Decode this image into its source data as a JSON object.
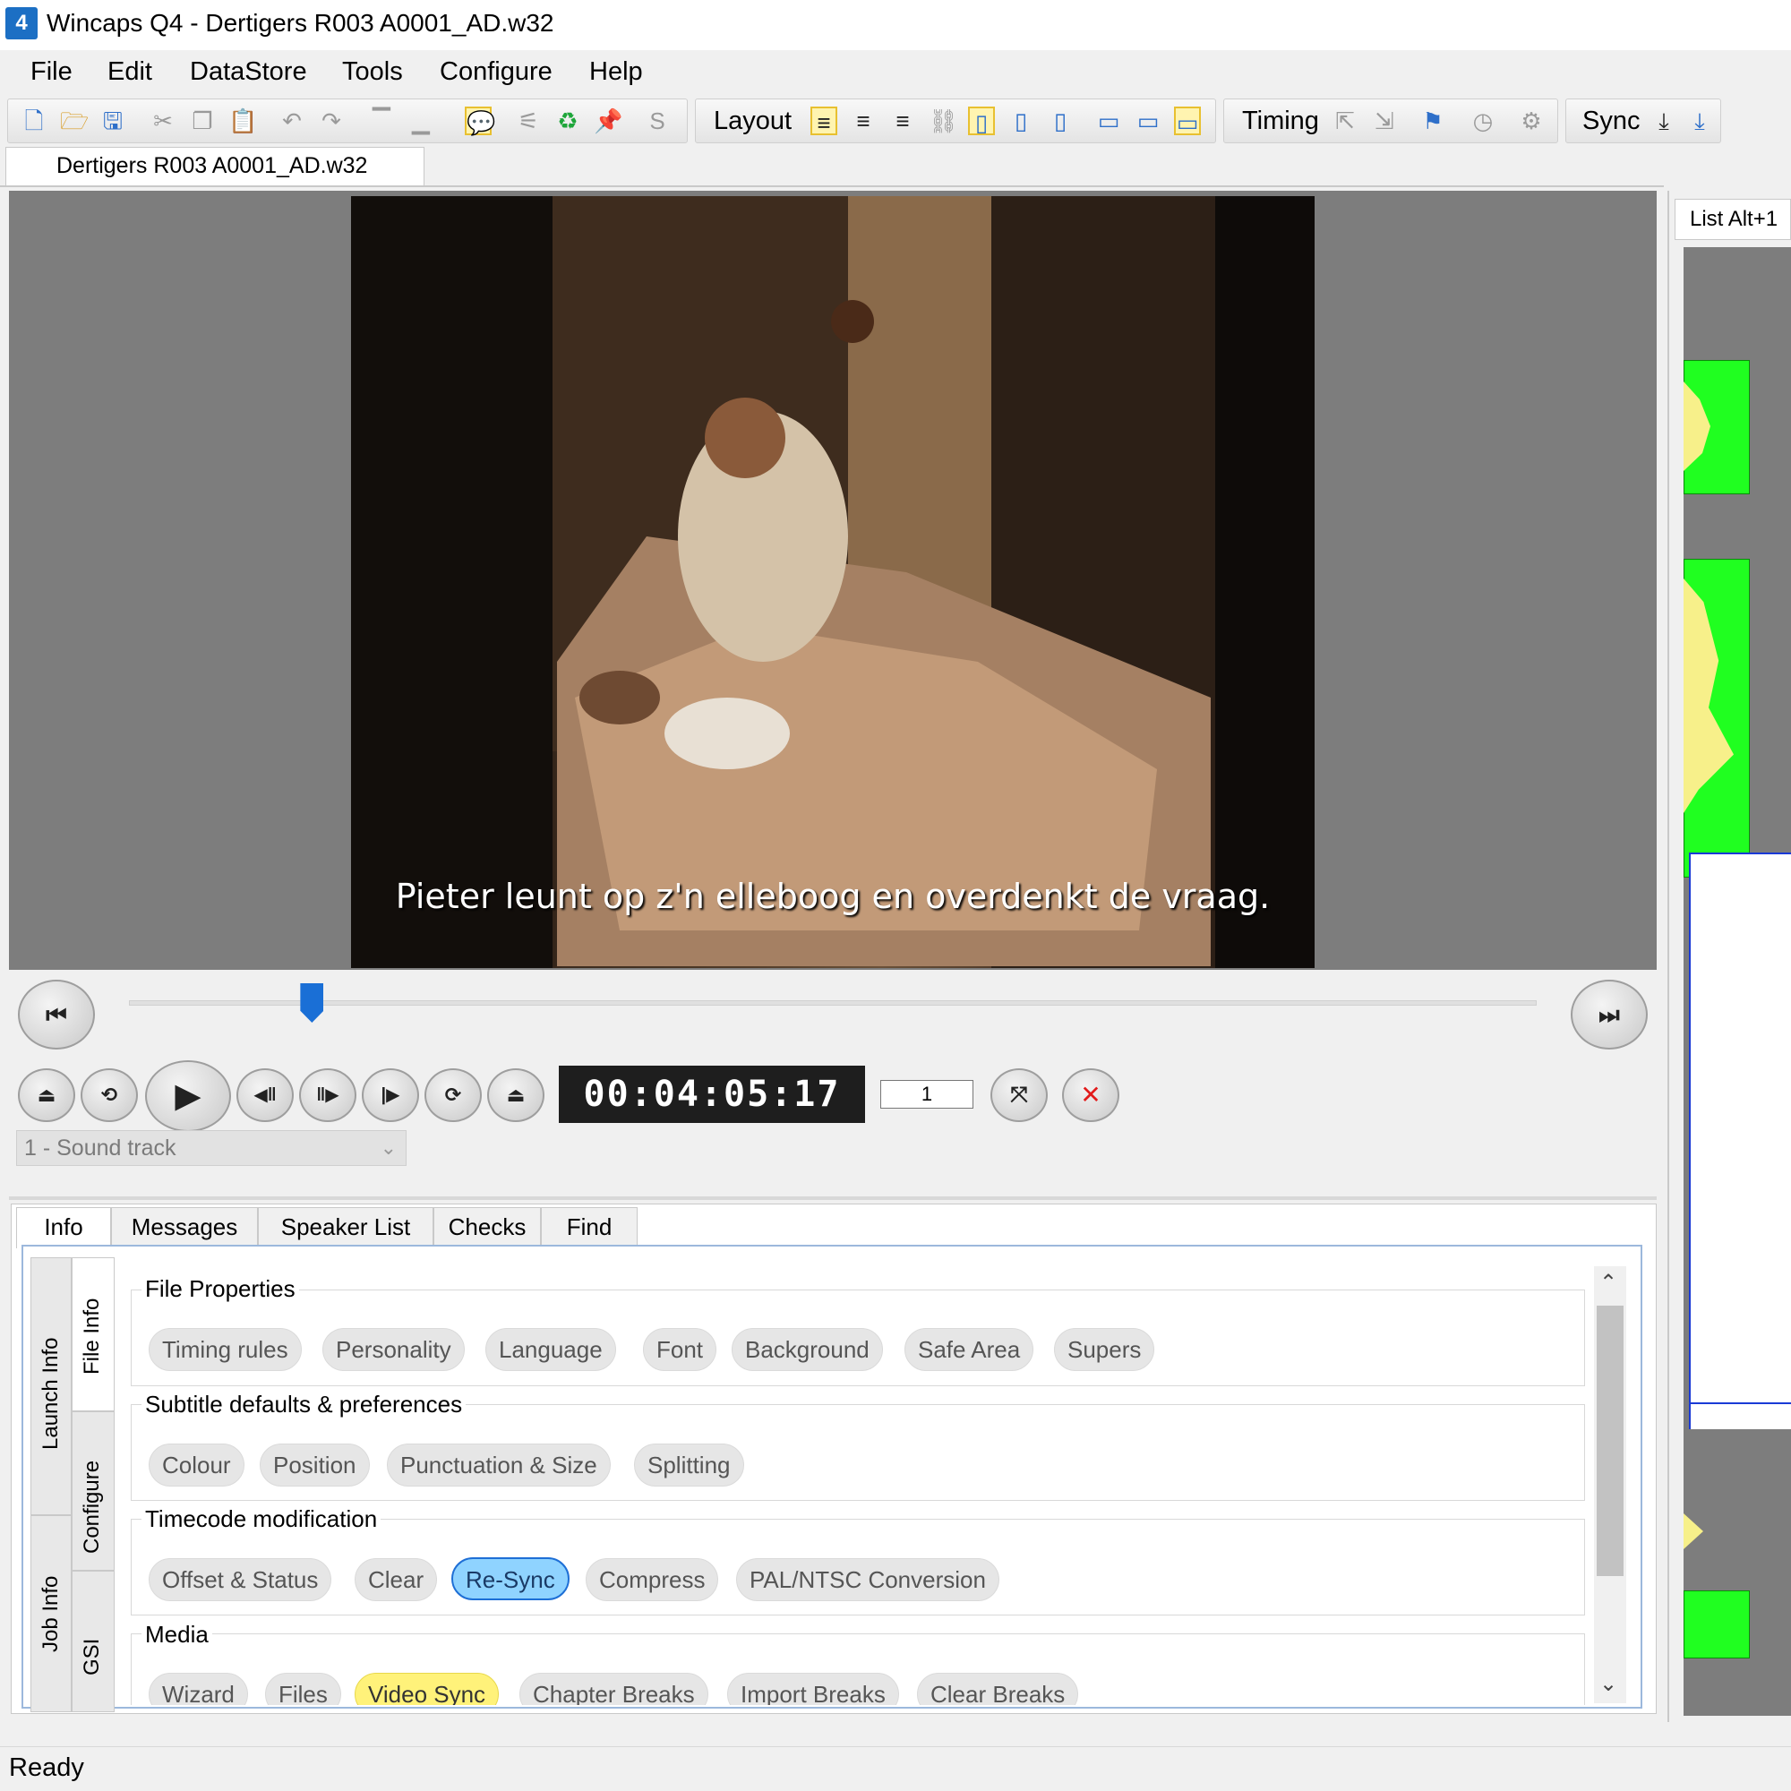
{
  "window": {
    "title": "Wincaps Q4 - Dertigers R003 A0001_AD.w32",
    "app_icon": "4"
  },
  "menu": [
    "File",
    "Edit",
    "DataStore",
    "Tools",
    "Configure",
    "Help"
  ],
  "toolbar": {
    "layout_label": "Layout",
    "timing_label": "Timing",
    "sync_label": "Sync"
  },
  "document_tab": "Dertigers R003 A0001_AD.w32",
  "video": {
    "subtitle": "Pieter leunt op z'n elleboog en overdenkt de vraag."
  },
  "transport": {
    "timecode": "00:04:05:17",
    "frame_step": "1",
    "sound_track": "1 - Sound track",
    "position_fraction": 0.13
  },
  "bottom_tabs": [
    "Info",
    "Messages",
    "Speaker List",
    "Checks",
    "Find"
  ],
  "side_tabs": {
    "left": [
      "Launch Info",
      "Job Info"
    ],
    "right": [
      "File Info",
      "Configure",
      "GSI"
    ]
  },
  "info": {
    "file_properties": {
      "title": "File Properties",
      "buttons": [
        "Timing rules",
        "Personality",
        "Language",
        "Font",
        "Background",
        "Safe Area",
        "Supers"
      ]
    },
    "subtitle_defaults": {
      "title": "Subtitle defaults & preferences",
      "buttons": [
        "Colour",
        "Position",
        "Punctuation & Size",
        "Splitting"
      ]
    },
    "timecode_mod": {
      "title": "Timecode modification",
      "buttons": [
        "Offset & Status",
        "Clear",
        "Re-Sync",
        "Compress",
        "PAL/NTSC Conversion"
      ]
    },
    "media": {
      "title": "Media",
      "buttons": [
        "Wizard",
        "Files",
        "Video Sync",
        "Chapter Breaks",
        "Import Breaks",
        "Clear Breaks"
      ]
    }
  },
  "right_panel": {
    "tab": "List Alt+1"
  },
  "status": "Ready",
  "colors": {
    "accent_blue": "#1a6fd6",
    "highlight_yellow": "#fff27a",
    "waveform_green": "#20ff20"
  }
}
